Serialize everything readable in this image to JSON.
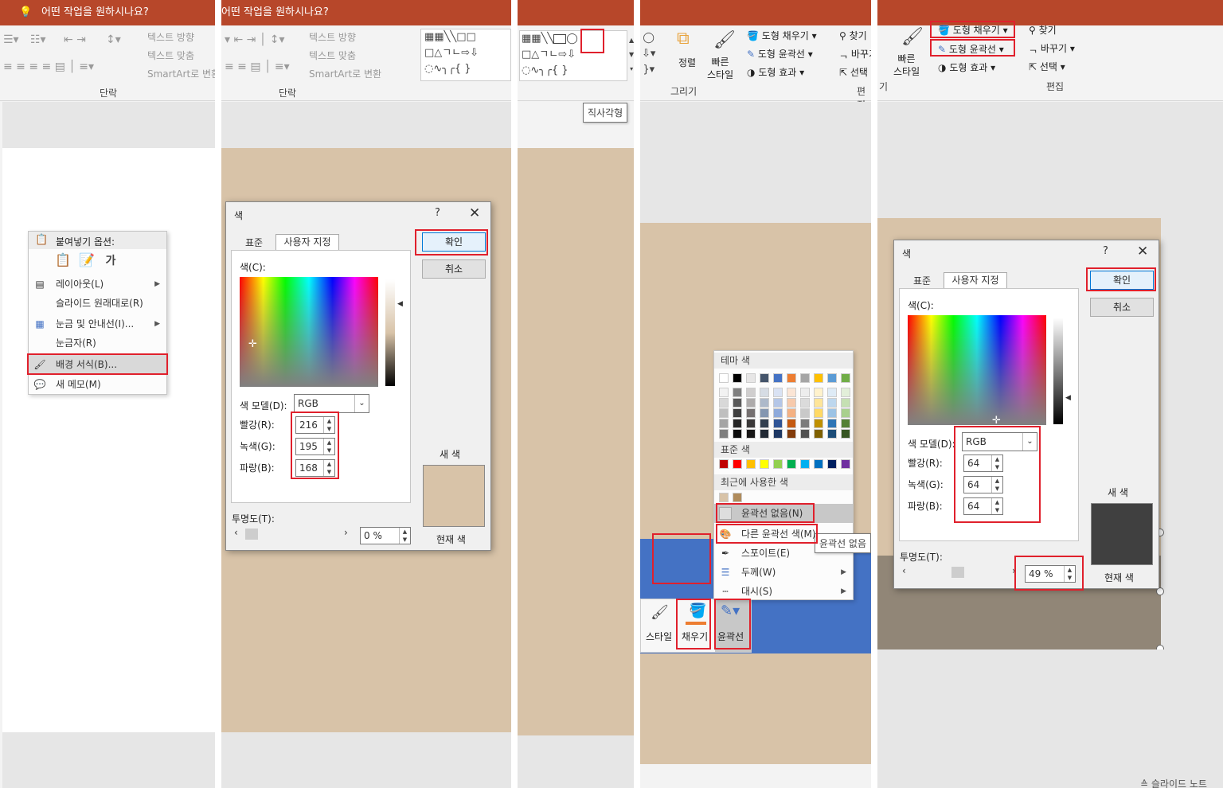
{
  "colors": {
    "title_bar": "#b7472a",
    "highlight": "#e0202c",
    "slide_bg": "#d8c3a8",
    "blue_shape": "#4472c4",
    "dark_shape": "#40403f"
  },
  "panel1": {
    "search_text": "어떤 작업을 원하시나요?",
    "ribbon_texts": [
      "텍스트 방향",
      "텍스트 맞춤",
      "SmartArt로 변환"
    ],
    "group_label": "단락",
    "context_menu": {
      "header": "붙여넣기 옵션:",
      "items": [
        {
          "label": "레이아웃(L)",
          "icon": "layout-icon",
          "arrow": true
        },
        {
          "label": "슬라이드 원래대로(R)",
          "icon": "",
          "arrow": false
        },
        {
          "label": "눈금 및 안내선(I)...",
          "icon": "grid-icon",
          "arrow": true
        },
        {
          "label": "눈금자(R)",
          "icon": "",
          "arrow": false
        },
        {
          "label": "배경 서식(B)...",
          "icon": "format-background-icon",
          "arrow": false
        },
        {
          "label": "새 메모(M)",
          "icon": "comment-icon",
          "arrow": false
        }
      ],
      "paste_icons": [
        "paste-theme-icon",
        "paste-keep-format-icon",
        "paste-text-only-icon"
      ]
    }
  },
  "panel2": {
    "search_text": "어떤 작업을 원하시나요?",
    "ribbon_texts": [
      "텍스트 방향",
      "텍스트 맞춤",
      "SmartArt로 변환"
    ],
    "group_label": "단락",
    "dialog": {
      "title": "색",
      "help": "?",
      "close": "✕",
      "tab_standard": "표준",
      "tab_custom": "사용자 지정",
      "colors_label": "색(C):",
      "model_label": "색 모델(D):",
      "model_value": "RGB",
      "red_label": "빨강(R):",
      "green_label": "녹색(G):",
      "blue_label": "파랑(B):",
      "red": "216",
      "green": "195",
      "blue": "168",
      "transparency_label": "투명도(T):",
      "transparency": "0 %",
      "transparency_fraction": 0.0,
      "ok": "확인",
      "cancel": "취소",
      "new_label": "새 색",
      "current_label": "현재 색",
      "new_color": "#d8c3a8"
    }
  },
  "panel3": {
    "tooltip": "직사각형"
  },
  "panel4": {
    "ribbon": {
      "arrange": "정렬",
      "quick_styles": "빠른\n스타일",
      "shape_fill": "도형 채우기",
      "shape_outline": "도형 윤곽선",
      "shape_effects": "도형 효과",
      "find": "찾기",
      "replace": "바꾸기",
      "select": "선택",
      "group_drawing": "그리기",
      "group_editing": "편집"
    },
    "outline_menu": {
      "theme_colors": "테마 색",
      "standard_colors": "표준 색",
      "recent_colors": "최근에 사용한 색",
      "no_outline": "윤곽선 없음(N)",
      "more_colors": "다른 윤곽선 색(M)...",
      "eyedropper": "스포이트(E)",
      "weight": "두께(W)",
      "dashes": "대시(S)",
      "tooltip": "윤곽선 없음",
      "theme_top": [
        "#ffffff",
        "#000000",
        "#e7e6e6",
        "#44546a",
        "#4472c4",
        "#ed7d31",
        "#a5a5a5",
        "#ffc000",
        "#5b9bd5",
        "#70ad47"
      ],
      "theme_shades": [
        [
          "#f2f2f2",
          "#808080",
          "#d0cece",
          "#d6dce4",
          "#d9e2f3",
          "#fbe5d5",
          "#ededed",
          "#fff2cc",
          "#deebf6",
          "#e2efd9"
        ],
        [
          "#d8d8d8",
          "#595959",
          "#aeabab",
          "#adb9ca",
          "#b4c6e7",
          "#f7caac",
          "#dbdbdb",
          "#fee599",
          "#bdd7ee",
          "#c5e0b3"
        ],
        [
          "#bfbfbf",
          "#3f3f3f",
          "#757070",
          "#8496b0",
          "#8eaadb",
          "#f4b183",
          "#c9c9c9",
          "#ffd965",
          "#9cc3e5",
          "#a8d08d"
        ],
        [
          "#a5a5a5",
          "#262626",
          "#3a3838",
          "#323f4f",
          "#2f5496",
          "#c55a11",
          "#7b7b7b",
          "#bf9000",
          "#2e75b5",
          "#538135"
        ],
        [
          "#7f7f7f",
          "#0c0c0c",
          "#171616",
          "#222a35",
          "#1e3864",
          "#833c0b",
          "#525252",
          "#7f6000",
          "#1e4e79",
          "#375623"
        ]
      ],
      "standard": [
        "#c00000",
        "#ff0000",
        "#ffc000",
        "#ffff00",
        "#92d050",
        "#00b050",
        "#00b0f0",
        "#0070c0",
        "#002060",
        "#7030a0"
      ],
      "recent": [
        "#d8c3a8",
        "#b08b5b"
      ]
    },
    "mini_toolbar": {
      "style": "스타일",
      "fill": "채우기",
      "outline": "윤곽선"
    }
  },
  "panel5": {
    "ribbon": {
      "shape_fill": "도형 채우기",
      "shape_outline": "도형 윤곽선",
      "shape_effects": "도형 효과",
      "quick_styles": "빠른\n스타일",
      "find": "찾기",
      "replace": "바꾸기",
      "select": "선택",
      "group_partial": "기",
      "group_editing": "편집"
    },
    "dialog": {
      "title": "색",
      "help": "?",
      "close": "✕",
      "tab_standard": "표준",
      "tab_custom": "사용자 지정",
      "colors_label": "색(C):",
      "model_label": "색 모델(D):",
      "model_value": "RGB",
      "red_label": "빨강(R):",
      "green_label": "녹색(G):",
      "blue_label": "파랑(B):",
      "red": "64",
      "green": "64",
      "blue": "64",
      "transparency_label": "투명도(T):",
      "transparency": "49 %",
      "transparency_fraction": 0.49,
      "ok": "확인",
      "cancel": "취소",
      "new_label": "새 색",
      "current_label": "현재 색",
      "new_color": "#404040"
    },
    "status": "슬라이드 노트"
  }
}
